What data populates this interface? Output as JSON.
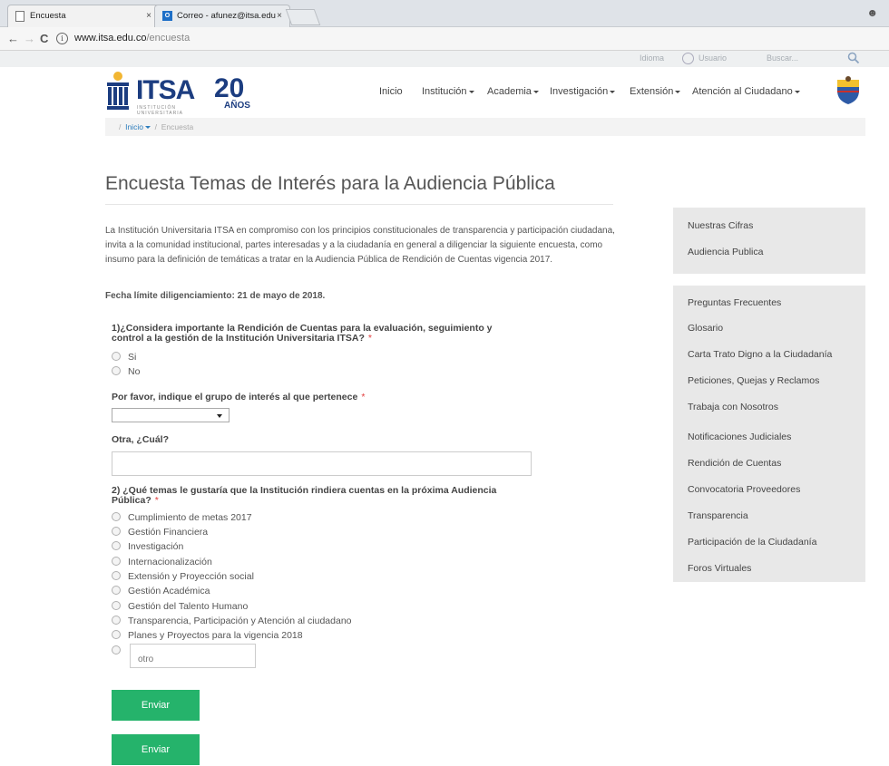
{
  "browser": {
    "tabs": [
      {
        "label": "Encuesta",
        "close": "×"
      },
      {
        "label": "Correo - afunez@itsa.edu",
        "close": "×"
      }
    ],
    "profile_icon": "account-icon",
    "url_domain": "www.itsa.edu.co",
    "url_path": "/encuesta",
    "nav_icons": [
      "back-icon",
      "forward-icon",
      "reload-icon",
      "info-icon"
    ]
  },
  "utility": {
    "idioma": "Idioma",
    "usuario": "Usuario",
    "search_placeholder": "Buscar..."
  },
  "brand": {
    "name": "ITSA",
    "subtitle_line1": "INSTITUCIÓN",
    "subtitle_line2": "UNIVERSITARIA",
    "anniversary": "20",
    "anniversary_word": "AÑOS",
    "accent": "#1c3d80"
  },
  "nav": {
    "items": [
      {
        "label": "Inicio"
      },
      {
        "label": "Institución"
      },
      {
        "label": "Academia"
      },
      {
        "label": "Investigación"
      },
      {
        "label": "Extensión"
      },
      {
        "label": "Atención al Ciudadano"
      }
    ]
  },
  "breadcrumb": {
    "home": "Inicio",
    "current": "Encuesta"
  },
  "page": {
    "title": "Encuesta Temas de Interés para la Audiencia Pública",
    "intro": "La Institución Universitaria ITSA en compromiso con los principios constitucionales de transparencia y participación ciudadana, invita a la comunidad institucional, partes interesadas y a la ciudadanía en general a diligenciar la siguiente encuesta, como insumo para la definición de temáticas a tratar en la Audiencia Pública de Rendición de Cuentas vigencia 2017.",
    "deadline": "Fecha límite diligenciamiento: 21 de mayo de 2018."
  },
  "form": {
    "q1": {
      "line1": "1)¿Considera importante la Rendición de Cuentas para la evaluación, seguimiento y",
      "line2": "control a la gestión de la Institución Universitaria ITSA?",
      "required": "*",
      "options": [
        "Si",
        "No"
      ]
    },
    "group": {
      "label": "Por favor, indique el grupo de interés al que pertenece",
      "required": "*",
      "selected": ""
    },
    "other": {
      "label": "Otra, ¿Cuál?",
      "value": ""
    },
    "q2": {
      "line1": "2) ¿Qué temas le gustaría que la Institución rindiera cuentas en la próxima Audiencia",
      "line2": "Pública?",
      "required": "*",
      "options": [
        "Cumplimiento de metas 2017",
        "Gestión Financiera",
        "Investigación",
        "Internacionalización",
        "Extensión y Proyección social",
        "Gestión Académica",
        "Gestión del Talento Humano",
        "Transparencia, Participación y Atención al ciudadano",
        "Planes y Proyectos para la vigencia 2018"
      ],
      "otro_placeholder": "otro"
    },
    "submit_label": "Enviar",
    "submit_label_2": "Enviar",
    "button_color": "#25b36b"
  },
  "sidebar": {
    "group1": [
      "Nuestras Cifras",
      "Audiencia Publica"
    ],
    "group2": [
      "Preguntas Frecuentes",
      "Glosario",
      "Carta Trato Digno a la Ciudadanía",
      "Peticiones, Quejas y Reclamos",
      "Trabaja con Nosotros",
      "Notificaciones Judiciales",
      "Rendición de Cuentas",
      "Convocatoria Proveedores",
      "Transparencia",
      "Participación de la Ciudadanía",
      "Foros Virtuales"
    ]
  }
}
